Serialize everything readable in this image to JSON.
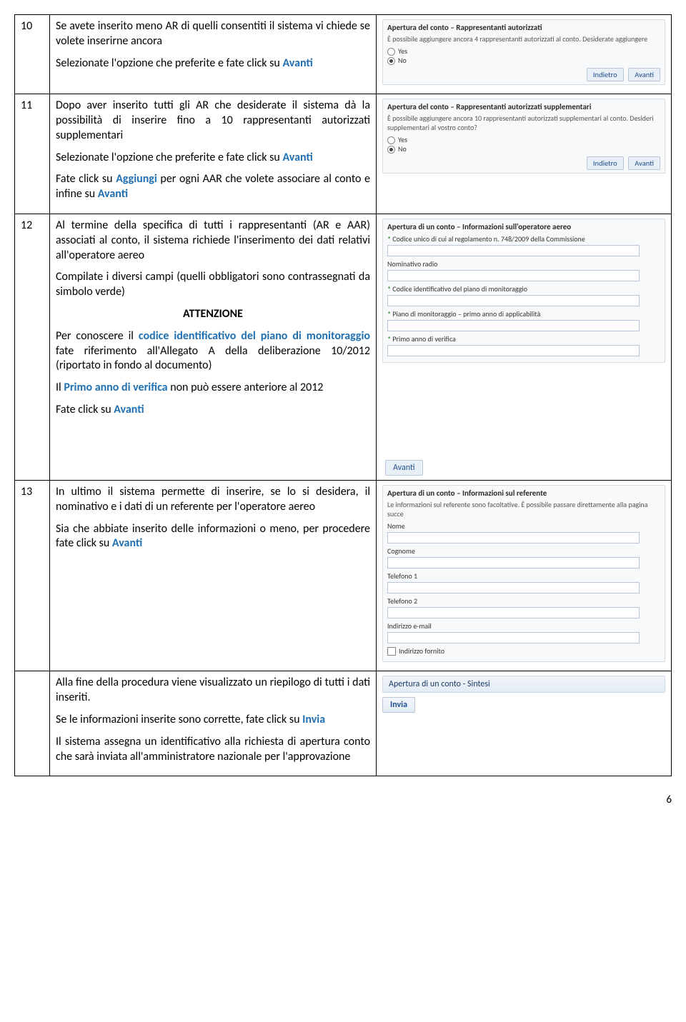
{
  "rows": {
    "r10": {
      "num": "10",
      "p1a": "Se avete inserito meno AR di quelli consentiti il sistema vi chiede se volete inserirne ancora",
      "p2a": "Selezionate l'opzione che preferite e fate click su ",
      "p2b": "Avanti"
    },
    "r11": {
      "num": "11",
      "p1a": "Dopo aver inserito tutti gli AR che desiderate il sistema dà la possibilità di inserire fino a 10 rappresentanti autorizzati supplementari",
      "p2a": "Selezionate l'opzione che preferite e fate click su ",
      "p2b": "Avanti",
      "p3a": "Fate click su ",
      "p3b": "Aggiungi",
      "p3c": " per ogni AAR che volete associare al conto e infine su ",
      "p3d": "Avanti"
    },
    "r12": {
      "num": "12",
      "p1": "Al termine della specifica di tutti i rappresentanti (AR e AAR) associati al conto, il sistema richiede l'inserimento dei dati relativi all'operatore aereo",
      "p2": "Compilate i diversi campi (quelli obbligatori sono contrassegnati da simbolo verde)",
      "att": "ATTENZIONE",
      "p3a": "Per conoscere il ",
      "p3b": "codice identificativo del piano di monitoraggio",
      "p3c": " fate riferimento all'Allegato A della deliberazione 10/2012 (riportato in fondo al documento)",
      "p4a": "Il ",
      "p4b": "Primo anno di verifica",
      "p4c": " non può essere anteriore al 2012",
      "p5a": "Fate click su ",
      "p5b": "Avanti"
    },
    "r13": {
      "num": "13",
      "p1": "In ultimo il sistema permette di inserire, se lo si desidera, il nominativo e i dati di un referente per l'operatore aereo",
      "p2a": "Sia che abbiate inserito delle informazioni o meno, per procedere fate click su ",
      "p2b": "Avanti"
    },
    "rfinal": {
      "p1": "Alla fine della procedura viene visualizzato un riepilogo di tutti i dati inseriti.",
      "p2a": "Se le informazioni inserite sono corrette, fate click su ",
      "p2b": "Invia",
      "p3": "Il sistema assegna un identificativo alla richiesta di apertura conto che sarà inviata all'amministratore nazionale per l'approvazione"
    }
  },
  "shots": {
    "s10": {
      "title": "Apertura del conto – Rappresentanti autorizzati",
      "sub": "È possibile aggiungere ancora 4 rappresentanti autorizzati al conto. Desiderate aggiungere",
      "optYes": "Yes",
      "optNo": "No",
      "back": "Indietro",
      "next": "Avanti"
    },
    "s11": {
      "title": "Apertura del conto – Rappresentanti autorizzati supplementari",
      "sub": "È possibile aggiungere ancora 10 rappresentanti autorizzati supplementari al conto. Desideri supplementari al vostro conto?",
      "optYes": "Yes",
      "optNo": "No",
      "back": "Indietro",
      "next": "Avanti"
    },
    "s12": {
      "title": "Apertura di un conto – Informazioni sull'operatore aereo",
      "f1": "Codice unico di cui al regolamento n. 748/2009 della Commissione",
      "f2": "Nominativo radio",
      "f3": "Codice identificativo del piano di monitoraggio",
      "f4": "Piano di monitoraggio – primo anno di applicabilità",
      "f5": "Primo anno di verifica",
      "next": "Avanti"
    },
    "s13": {
      "title": "Apertura di un conto – Informazioni sul referente",
      "sub": "Le informazioni sul referente sono facoltative. È possibile passare direttamente alla pagina succe",
      "f1": "Nome",
      "f2": "Cognome",
      "f3": "Telefono 1",
      "f4": "Telefono 2",
      "f5": "Indirizzo e-mail",
      "f6": "Indirizzo fornito"
    },
    "sfinal": {
      "bar": "Apertura di un conto - Sintesi",
      "btn": "Invia"
    }
  },
  "pageNum": "6"
}
